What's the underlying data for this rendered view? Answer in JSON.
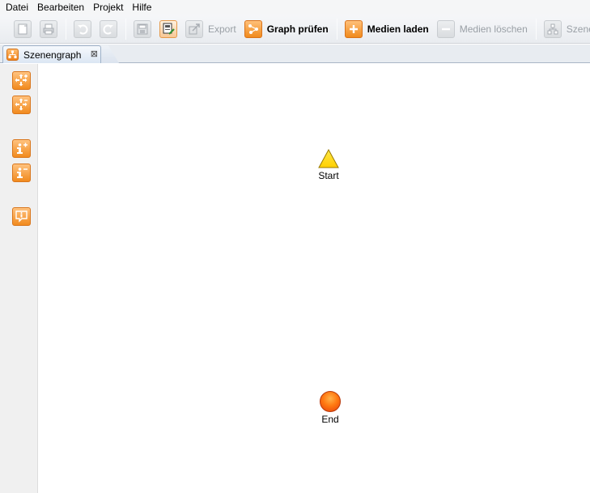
{
  "menu": {
    "items": [
      "Datei",
      "Bearbeiten",
      "Projekt",
      "Hilfe"
    ]
  },
  "toolbar": {
    "new_icon": "new-document-icon",
    "print_icon": "print-icon",
    "undo_icon": "undo-icon",
    "redo_icon": "redo-icon",
    "save_icon": "save-icon",
    "save_as_icon": "save-as-icon",
    "export_label": "Export",
    "graph_check_label": "Graph prüfen",
    "load_media_label": "Medien laden",
    "delete_media_label": "Medien löschen",
    "scenegraph_label": "Szenengr"
  },
  "tab": {
    "label": "Szenengraph",
    "close_glyph": "⊠"
  },
  "sidebar": {
    "tools": [
      "move-plus-icon",
      "move-minus-icon",
      "info-plus-icon",
      "info-minus-icon",
      "info-bubble-icon"
    ]
  },
  "graph": {
    "start_label": "Start",
    "end_label": "End"
  },
  "colors": {
    "accent": "#f08a1c",
    "start_node": "#ffd700",
    "end_node": "#ff6a10"
  }
}
